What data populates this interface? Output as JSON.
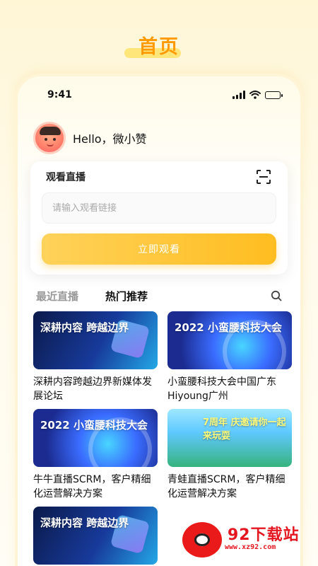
{
  "page_heading": "首页",
  "status_bar": {
    "time": "9:41"
  },
  "greeting": "Hello，微小赞",
  "watch_live": {
    "title": "观看直播",
    "input_placeholder": "请输入观看链接",
    "button_label": "立即观看"
  },
  "tabs": [
    {
      "label": "最近直播",
      "active": false
    },
    {
      "label": "热门推荐",
      "active": true
    }
  ],
  "cards": [
    {
      "title": "深耕内容跨越边界新媒体发展论坛",
      "thumb_text": "深耕内容 跨越边界",
      "theme": "dark-blue"
    },
    {
      "title": "小蛮腰科技大会中国广东Hiyoung广州",
      "thumb_text": "2022 小蛮腰科技大会",
      "theme": "blue-swirl"
    },
    {
      "title": "牛牛直播SCRM，客户精细化运营解决方案",
      "thumb_text": "2022 小蛮腰科技大会",
      "theme": "blue-swirl"
    },
    {
      "title": "青蛙直播SCRM，客户精细化运营解决方案",
      "thumb_text": "7周年 庆邀请你一起来玩耍",
      "theme": "sky-green"
    },
    {
      "title": "",
      "thumb_text": "深耕内容 跨越边界",
      "theme": "dark-blue"
    }
  ],
  "watermark": {
    "name": "92下载站",
    "url": "www.xz92.com"
  },
  "colors": {
    "accent": "#ffbd20",
    "heading": "#ff9a00",
    "watermark": "#e4161f"
  }
}
